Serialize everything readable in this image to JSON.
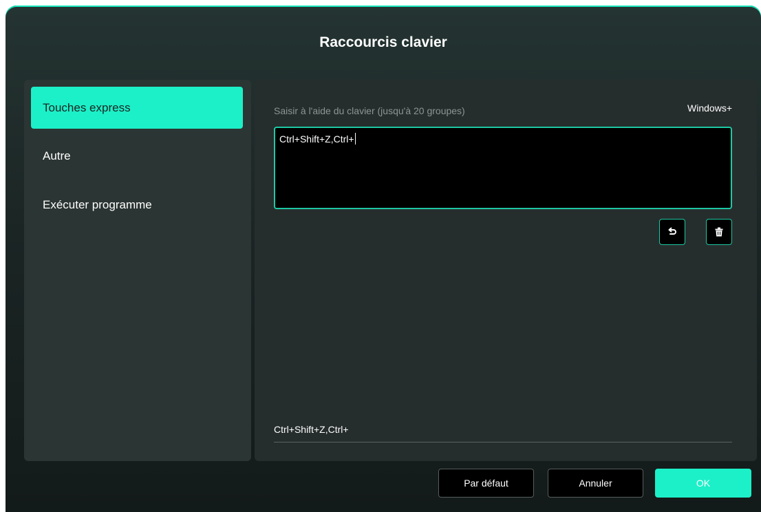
{
  "dialog": {
    "title": "Raccourcis clavier"
  },
  "sidebar": {
    "items": [
      {
        "label": "Touches express",
        "active": true
      },
      {
        "label": "Autre",
        "active": false
      },
      {
        "label": "Exécuter programme",
        "active": false
      }
    ]
  },
  "main": {
    "hint": "Saisir à l'aide du clavier (jusqu'à 20 groupes)",
    "modifier_label": "Windows+",
    "input_value": "Ctrl+Shift+Z,Ctrl+",
    "undo_icon": "undo-icon",
    "delete_icon": "trash-icon",
    "result_text": "Ctrl+Shift+Z,Ctrl+"
  },
  "footer": {
    "default_label": "Par défaut",
    "cancel_label": "Annuler",
    "ok_label": "OK"
  },
  "colors": {
    "accent": "#1cf0c8",
    "border_accent": "#1cc9a5",
    "panel": "#262e2d",
    "sidebar": "#2b3533"
  }
}
